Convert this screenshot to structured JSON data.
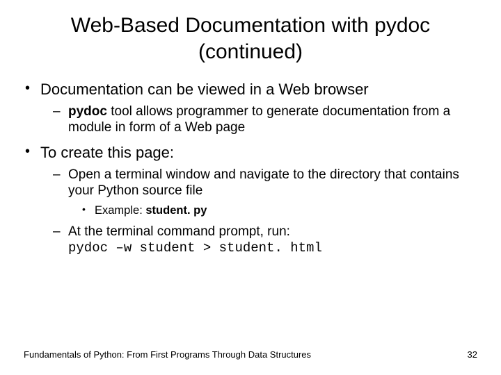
{
  "title": "Web-Based Documentation with pydoc (continued)",
  "bullets": {
    "b1": "Documentation can be viewed in a Web browser",
    "b1a_pre": "pydoc",
    "b1a_post": " tool allows programmer to generate documentation from a module in form of a Web page",
    "b2": "To create this page:",
    "b2a": "Open a terminal window and navigate to the directory that contains your Python source file",
    "b2a1_pre": "Example: ",
    "b2a1_bold": "student. py",
    "b2b_line1": "At the terminal command prompt, run:",
    "b2b_line2": "pydoc –w student > student. html"
  },
  "footer": {
    "left": "Fundamentals of Python: From First Programs Through Data Structures",
    "page": "32"
  }
}
